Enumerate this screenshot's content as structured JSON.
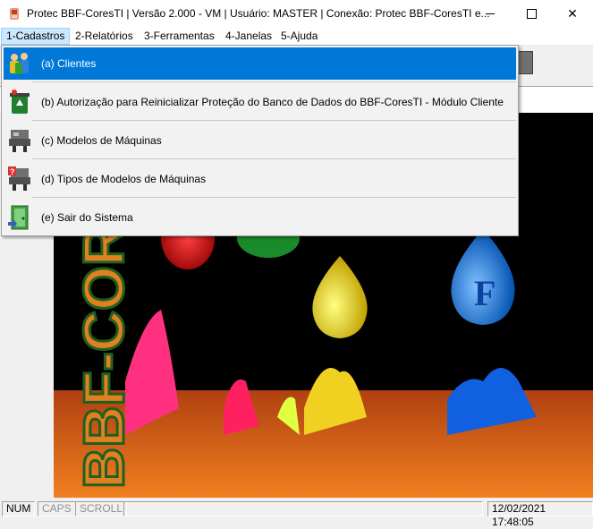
{
  "window": {
    "title": "Protec BBF-CoresTI | Versão 2.000 - VM | Usuário: MASTER | Conexão: Protec BBF-CoresTI e...",
    "controls": {
      "minimize_icon": "minimize-icon",
      "maximize_icon": "maximize-icon",
      "close_label": "✕"
    }
  },
  "menubar": {
    "items": [
      {
        "label": "1-Cadastros"
      },
      {
        "label": "2-Relatórios"
      },
      {
        "label": "3-Ferramentas"
      },
      {
        "label": "4-Janelas"
      },
      {
        "label": "5-Ajuda"
      }
    ]
  },
  "dropdown": {
    "items": [
      {
        "label": "(a) Clientes",
        "icon": "people-icon"
      },
      {
        "label": "(b) Autorização para Reinicializar Proteção do Banco de Dados do BBF-CoresTI - Módulo Cliente",
        "icon": "recycle-bin-icon"
      },
      {
        "label": "(c) Modelos de Máquinas",
        "icon": "machine-icon"
      },
      {
        "label": "(d) Tipos de Modelos de Máquinas",
        "icon": "machine-question-icon"
      },
      {
        "label": "(e) Sair do Sistema",
        "icon": "exit-door-icon"
      }
    ]
  },
  "background": {
    "logo_text": "BBF-CORES",
    "drop_letter": "F"
  },
  "statusbar": {
    "num": "NUM",
    "caps": "CAPS",
    "scroll": "SCROLL",
    "datetime": "12/02/2021 17:48:05"
  },
  "colors": {
    "selection": "#0078d7",
    "menu_active": "#cce8ff"
  }
}
